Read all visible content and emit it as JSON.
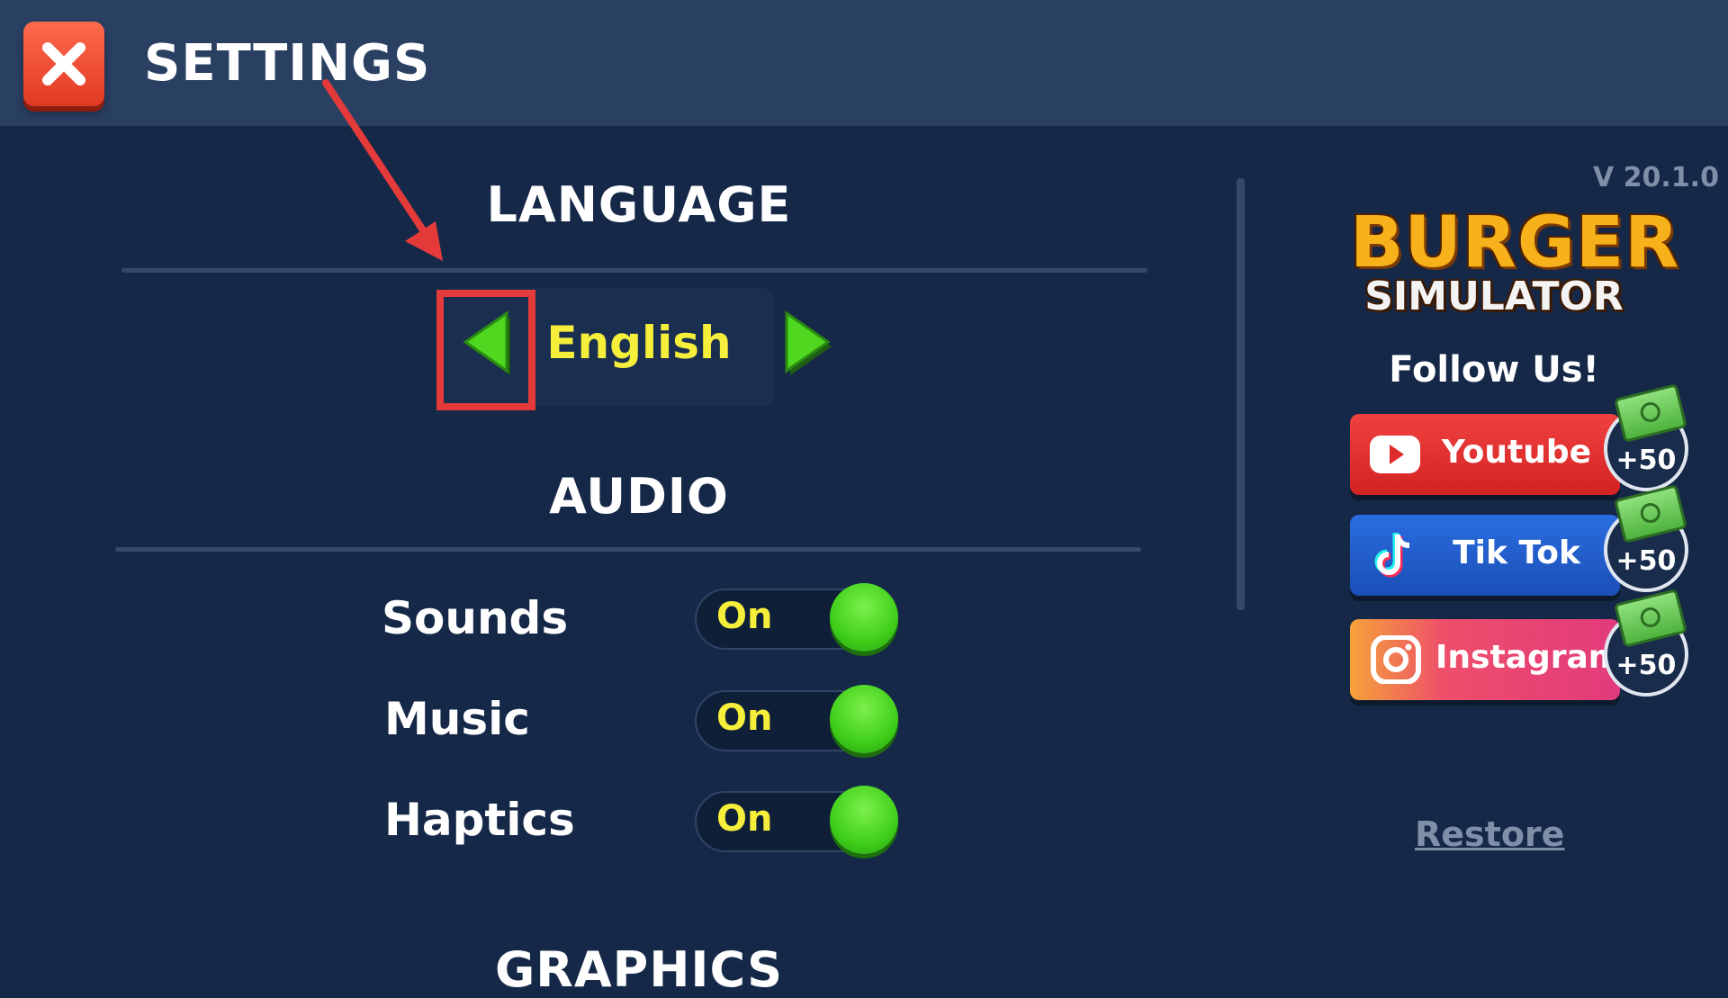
{
  "header": {
    "title": "SETTINGS",
    "close_icon": "close-x-icon"
  },
  "language": {
    "section_title": "LANGUAGE",
    "current_value": "English",
    "prev_icon": "arrow-left-icon",
    "next_icon": "arrow-right-icon"
  },
  "audio": {
    "section_title": "AUDIO",
    "rows": [
      {
        "label": "Sounds",
        "state": "On"
      },
      {
        "label": "Music",
        "state": "On"
      },
      {
        "label": "Haptics",
        "state": "On"
      }
    ]
  },
  "graphics": {
    "section_title": "GRAPHICS"
  },
  "sidebar": {
    "version": "V 20.1.0",
    "logo_line1": "BURGER",
    "logo_line2": "SIMULATOR",
    "follow_title": "Follow Us!",
    "socials": [
      {
        "label": "Youtube",
        "reward": "+50",
        "icon": "youtube-icon"
      },
      {
        "label": "Tik Tok",
        "reward": "+50",
        "icon": "tiktok-icon"
      },
      {
        "label": "Instagram",
        "reward": "+50",
        "icon": "instagram-icon"
      }
    ],
    "restore_label": "Restore"
  },
  "colors": {
    "background": "#152848",
    "header": "#2a4063",
    "accent_yellow": "#f5ee3a",
    "toggle_green": "#3fcf1a",
    "highlight_red": "#e53a3a"
  }
}
